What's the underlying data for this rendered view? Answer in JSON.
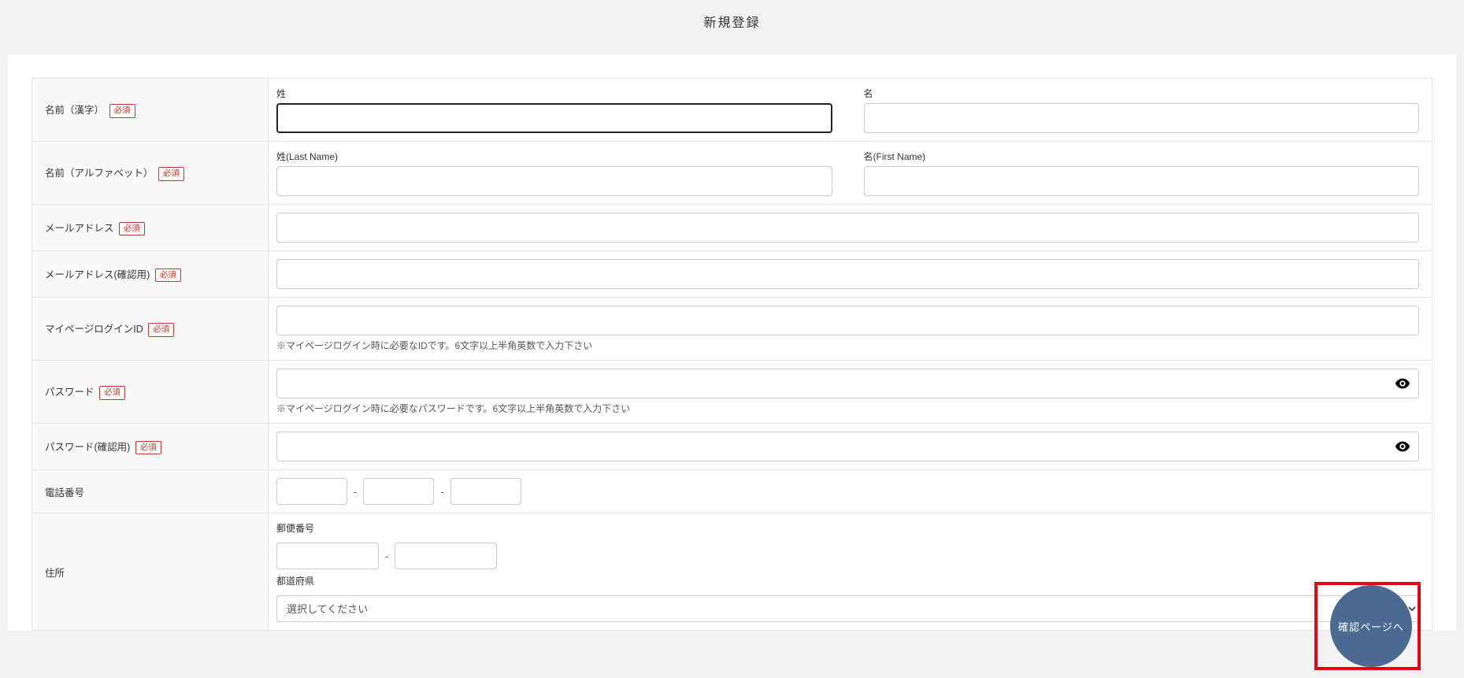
{
  "page": {
    "title": "新規登録"
  },
  "labels": {
    "required": "必須"
  },
  "rows": {
    "name_kanji": {
      "label": "名前（漢字）",
      "required": true,
      "sei_label": "姓",
      "mei_label": "名",
      "sei_value": "",
      "mei_value": ""
    },
    "name_alpha": {
      "label": "名前（アルファベット）",
      "required": true,
      "last_label": "姓(Last Name)",
      "first_label": "名(First Name)",
      "last_value": "",
      "first_value": ""
    },
    "email": {
      "label": "メールアドレス",
      "required": true,
      "value": ""
    },
    "email_confirm": {
      "label": "メールアドレス(確認用)",
      "required": true,
      "value": ""
    },
    "login_id": {
      "label": "マイページログインID",
      "required": true,
      "value": "",
      "help": "※マイページログイン時に必要なIDです。6文字以上半角英数で入力下さい"
    },
    "password": {
      "label": "パスワード",
      "required": true,
      "value": "",
      "help": "※マイページログイン時に必要なパスワードです。6文字以上半角英数で入力下さい"
    },
    "password_confirm": {
      "label": "パスワード(確認用)",
      "required": true,
      "value": ""
    },
    "phone": {
      "label": "電話番号",
      "required": false,
      "p1": "",
      "p2": "",
      "p3": ""
    },
    "address": {
      "label": "住所",
      "required": false,
      "zip_label": "郵便番号",
      "zip1": "",
      "zip2": "",
      "pref_label": "都道府県",
      "pref_selected": "選択してください"
    }
  },
  "fab": {
    "label": "確認ページへ"
  }
}
